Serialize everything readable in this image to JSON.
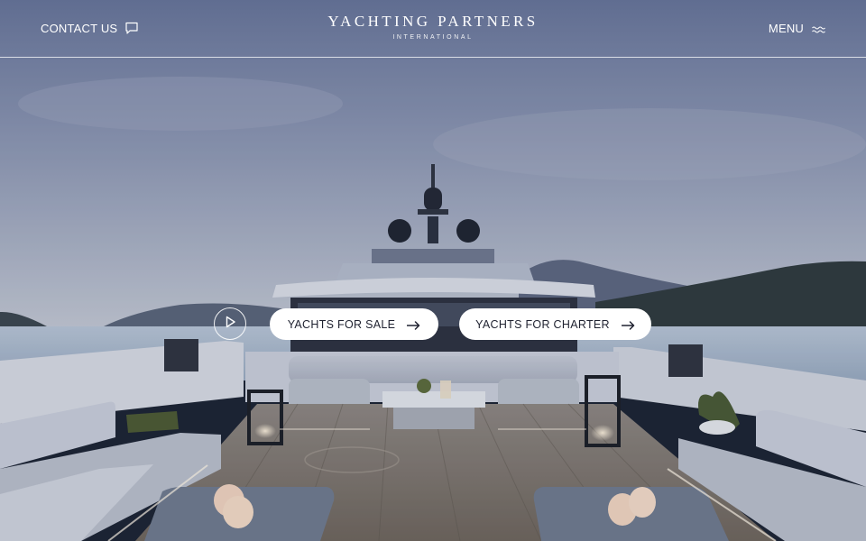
{
  "header": {
    "contact_label": "CONTACT US",
    "brand_name": "YACHTING PARTNERS",
    "brand_sub": "INTERNATIONAL",
    "menu_label": "MENU"
  },
  "hero": {
    "cta_sale": "YACHTS FOR SALE",
    "cta_charter": "YACHTS FOR CHARTER"
  },
  "icons": {
    "contact": "chat-bubble-icon",
    "menu": "waves-icon",
    "play": "play-icon",
    "cta": "arrow-right-icon"
  },
  "colors": {
    "sky_top": "#6b7896",
    "sky_bottom": "#b9c0cf",
    "sea": "#aebdd0",
    "deck": "#8a8078",
    "pill_bg": "#ffffff",
    "pill_text": "#1f2230"
  }
}
